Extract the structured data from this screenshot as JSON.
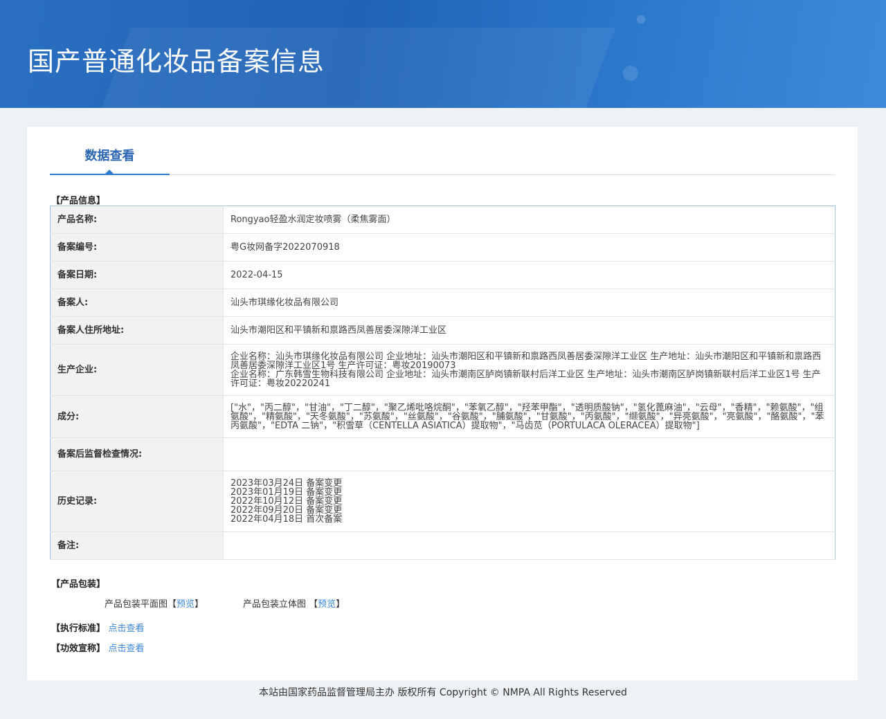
{
  "header": {
    "title": "国产普通化妆品备案信息"
  },
  "tab": {
    "label": "数据查看"
  },
  "sections": {
    "product_info": "【产品信息】",
    "packaging": "【产品包装】",
    "standard": "【执行标准】",
    "efficacy": "【功效宣称】"
  },
  "rows": [
    {
      "label": "产品名称:",
      "value": "Rongyao轻盈水润定妆喷雾（柔焦雾面）"
    },
    {
      "label": "备案编号:",
      "value": "粤G妆网备字2022070918"
    },
    {
      "label": "备案日期:",
      "value": "2022-04-15"
    },
    {
      "label": "备案人:",
      "value": "汕头市琪缘化妆品有限公司"
    },
    {
      "label": "备案人住所地址:",
      "value": "汕头市潮阳区和平镇新和禀路西凤善居委深隙洋工业区"
    },
    {
      "label": "生产企业:",
      "lines": [
        "企业名称：汕头市琪缘化妆品有限公司 企业地址：汕头市潮阳区和平镇新和禀路西凤善居委深隙洋工业区 生产地址：汕头市潮阳区和平镇新和禀路西凤善居委深隙洋工业区1号 生产许可证：粤妆20190073",
        "企业名称：广东韩雪生物科技有限公司 企业地址：汕头市潮南区胪岗镇新联村后洋工业区 生产地址：汕头市潮南区胪岗镇新联村后洋工业区1号 生产许可证：粤妆20220241"
      ]
    },
    {
      "label": "成分:",
      "value": "[\"水\"，\"丙二醇\"，\"甘油\"，\"丁二醇\"，\"聚乙烯吡咯烷酮\"，\"苯氧乙醇\"，\"羟苯甲酯\"，\"透明质酸钠\"，\"氢化蓖麻油\"，\"云母\"，\"香精\"，\"赖氨酸\"，\"组氨酸\"，\"精氨酸\"，\"天冬氨酸\"，\"苏氨酸\"，\"丝氨酸\"，\"谷氨酸\"，\"脯氨酸\"，\"甘氨酸\"，\"丙氨酸\"，\"缬氨酸\"，\"异亮氨酸\"，\"亮氨酸\"，\"酪氨酸\"，\"苯丙氨酸\"，\"EDTA 二钠\"，\"积雪草（CENTELLA ASIATICA）提取物\"，\"马齿苋（PORTULACA OLERACEA）提取物\"]"
    },
    {
      "label": "备案后监督检查情况:",
      "value": ""
    },
    {
      "label": "历史记录:",
      "lines": [
        "2023年03月24日 备案变更",
        "2023年01月19日 备案变更",
        "2022年10月12日 备案变更",
        "2022年09月20日 备案变更",
        "2022年04月18日 首次备案"
      ]
    },
    {
      "label": "备注:",
      "value": ""
    }
  ],
  "packaging": {
    "flat_label": "产品包装平面图",
    "solid_label": "产品包装立体图",
    "bracket_open": "【",
    "bracket_close": "】",
    "preview": "预览"
  },
  "links": {
    "view": "点击查看"
  },
  "footer": {
    "text": "本站由国家药品监督管理局主办 版权所有 Copyright © NMPA All Rights Reserved"
  }
}
